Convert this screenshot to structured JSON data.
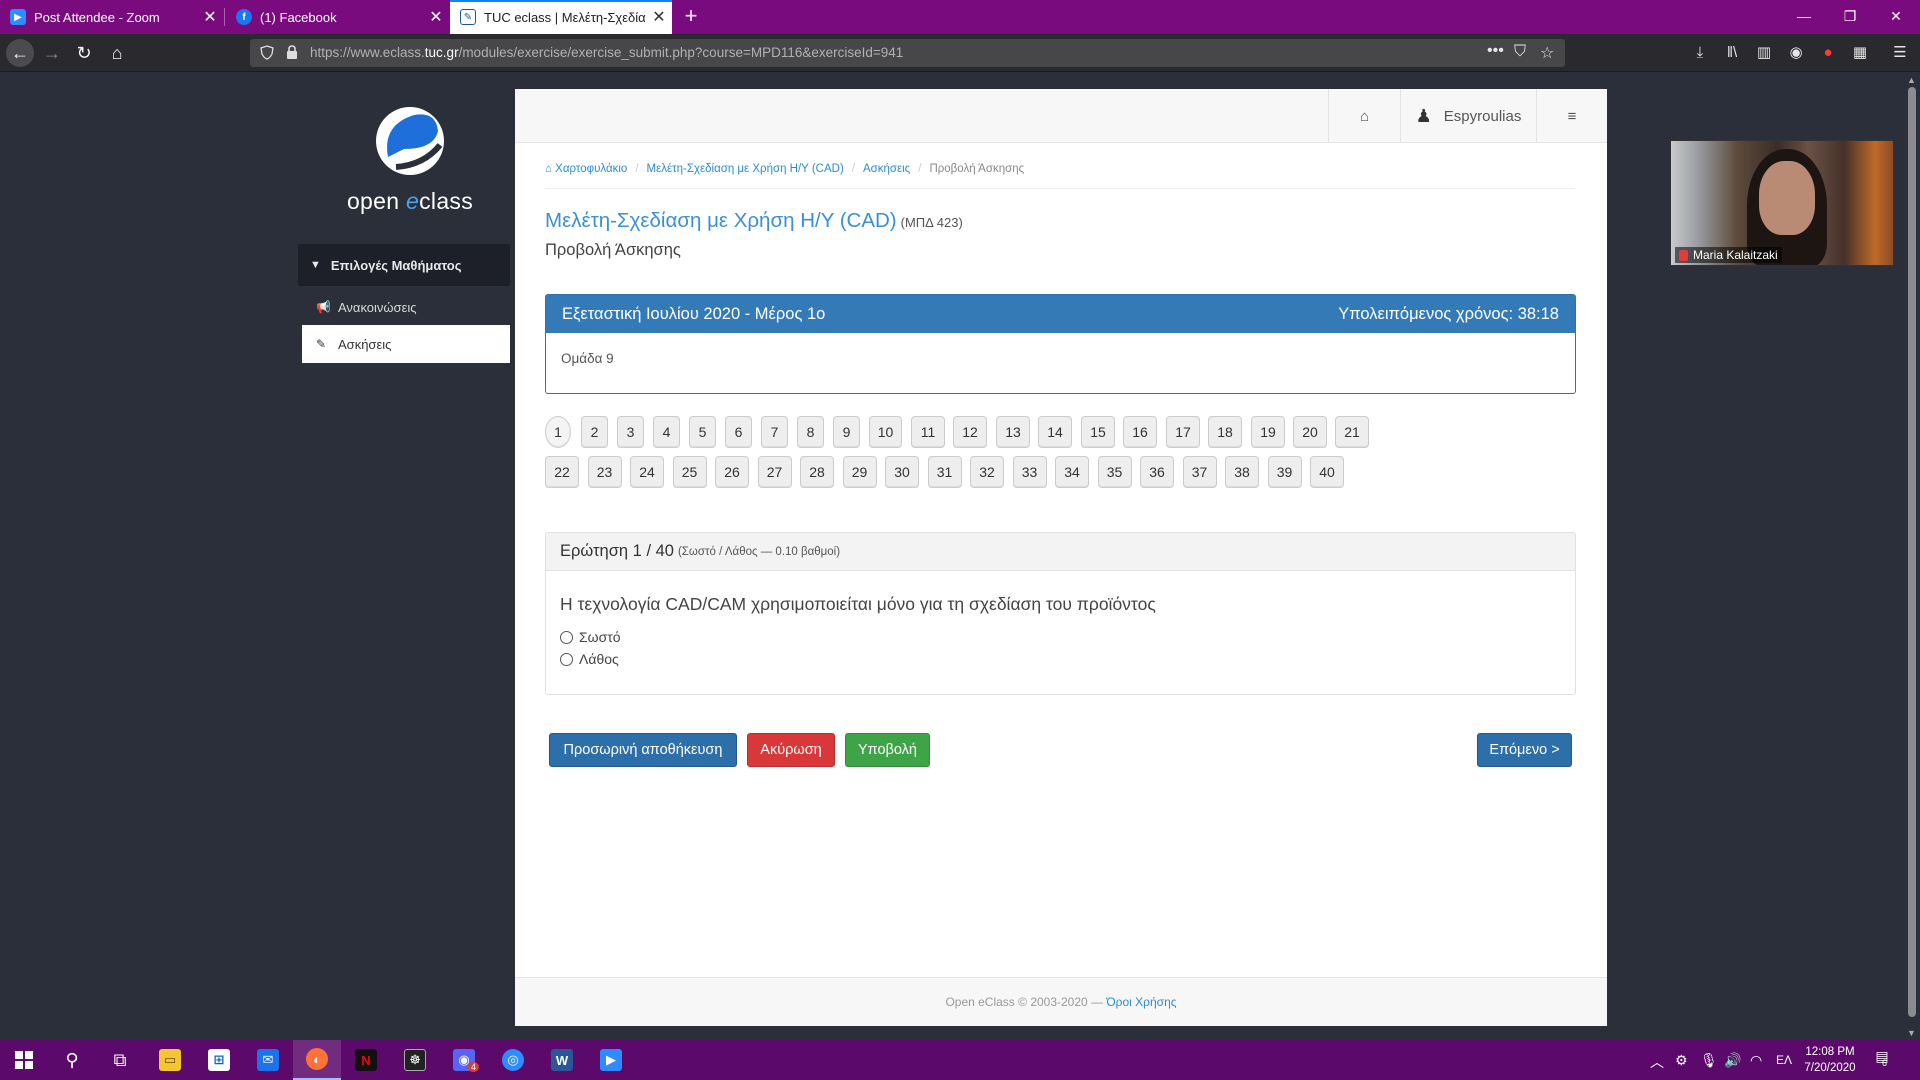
{
  "browser": {
    "tabs": [
      {
        "label": "Post Attendee - Zoom",
        "icon": "zoom-icon",
        "color": "#2d8cff"
      },
      {
        "label": "(1) Facebook",
        "icon": "facebook-icon",
        "color": "#1877f2"
      },
      {
        "label": "TUC eclass | Μελέτη-Σχεδίαση με",
        "icon": "eclass-icon",
        "color": "#1f5b8c"
      }
    ],
    "url_prefix": "https://www.eclass.",
    "url_domain": "tuc.gr",
    "url_path": "/modules/exercise/exercise_submit.php?course=MPD116&exerciseId=941",
    "win_controls": {
      "minimize": "—",
      "restore": "❐",
      "close": "✕"
    }
  },
  "sidebar": {
    "logo": {
      "text_prefix": "open ",
      "text_accent": "e",
      "text_suffix": "class"
    },
    "menu_header": "Επιλογές Μαθήματος",
    "items": [
      {
        "label": "Ανακοινώσεις",
        "icon": "megaphone-icon"
      },
      {
        "label": "Ασκήσεις",
        "icon": "edit-icon"
      }
    ]
  },
  "header": {
    "username": "Espyroulias",
    "icons": {
      "home": "home-icon",
      "user": "user-icon",
      "settings": "sliders-icon"
    }
  },
  "breadcrumb": [
    {
      "label": "Χαρτοφυλάκιο",
      "link": true
    },
    {
      "label": "Μελέτη-Σχεδίαση με Χρήση Η/Υ (CAD)",
      "link": true
    },
    {
      "label": "Ασκήσεις",
      "link": true
    },
    {
      "label": "Προβολή Άσκησης",
      "link": false
    }
  ],
  "course": {
    "title": "Μελέτη-Σχεδίαση με Χρήση Η/Υ (CAD)",
    "code": "(ΜΠΔ 423)",
    "subtitle": "Προβολή Άσκησης"
  },
  "exam": {
    "title": "Εξεταστική Ιουλίου 2020 - Μέρος 1ο",
    "timer": "Υπολειπόμενος χρόνος: 38:18",
    "group": "Ομάδα 9"
  },
  "question_nav": {
    "row1": [
      "1",
      "2",
      "3",
      "4",
      "5",
      "6",
      "7",
      "8",
      "9",
      "10",
      "11",
      "12",
      "13",
      "14",
      "15",
      "16",
      "17",
      "18",
      "19",
      "20",
      "21"
    ],
    "row2": [
      "22",
      "23",
      "24",
      "25",
      "26",
      "27",
      "28",
      "29",
      "30",
      "31",
      "32",
      "33",
      "34",
      "35",
      "36",
      "37",
      "38",
      "39",
      "40"
    ],
    "current": "1"
  },
  "question": {
    "heading": "Ερώτηση 1 / 40",
    "meta": "(Σωστό / Λάθος — 0.10 βαθμοί)",
    "text": "Η τεχνολογία CAD/CAM χρησιμοποιείται μόνο για τη σχεδίαση του προϊόντος",
    "options": [
      "Σωστό",
      "Λάθος"
    ]
  },
  "buttons": {
    "save": "Προσωρινή αποθήκευση",
    "cancel": "Ακύρωση",
    "submit": "Υποβολή",
    "next": "Επόμενο >"
  },
  "footer": {
    "copyright": "Open eClass © 2003-2020 — ",
    "terms": "Όροι Χρήσης"
  },
  "zoom_overlay": {
    "participant": "Maria Kalaitzaki"
  },
  "taskbar": {
    "clock_time": "12:08 PM",
    "clock_date": "7/20/2020",
    "language": "ΕΛ",
    "notification_count": "6",
    "app_badge": "4"
  },
  "colors": {
    "tabbar": "#7a0b7e",
    "taskbar": "#5b0a6b",
    "primary": "#347ab7",
    "danger": "#d9383a",
    "success": "#3fa447",
    "link": "#2b8ccf"
  }
}
